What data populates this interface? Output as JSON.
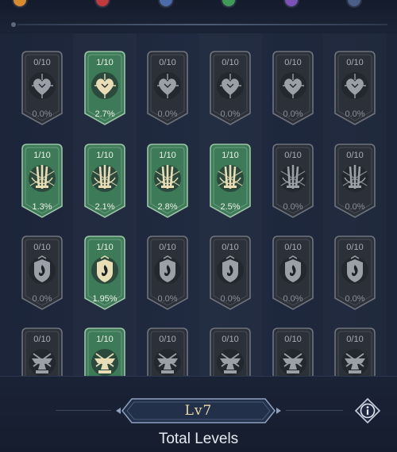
{
  "top_tabs": [
    {
      "icon": "orange-element-icon",
      "color": "#d98a2a"
    },
    {
      "icon": "red-element-icon",
      "color": "#c0393c"
    },
    {
      "icon": "blue-element-icon",
      "color": "#4a6aa8"
    },
    {
      "icon": "green-element-icon",
      "color": "#3f9a58"
    },
    {
      "icon": "purple-element-icon",
      "color": "#7a52b8"
    },
    {
      "icon": "navy-element-icon",
      "color": "#4b5e86"
    }
  ],
  "colors": {
    "active_fill": "#3d7a57",
    "inactive_fill": "#2c3038",
    "level_text": "#ecd9a6"
  },
  "rows": [
    {
      "emblem": "heart-icon",
      "cells": [
        {
          "level": "0/10",
          "percent": "0.0%",
          "active": false
        },
        {
          "level": "1/10",
          "percent": "2.7%",
          "active": true
        },
        {
          "level": "0/10",
          "percent": "0.0%",
          "active": false
        },
        {
          "level": "0/10",
          "percent": "0.0%",
          "active": false
        },
        {
          "level": "0/10",
          "percent": "0.0%",
          "active": false
        },
        {
          "level": "0/10",
          "percent": "0.0%",
          "active": false
        }
      ]
    },
    {
      "emblem": "swords-icon",
      "cells": [
        {
          "level": "1/10",
          "percent": "1.3%",
          "active": true
        },
        {
          "level": "1/10",
          "percent": "2.1%",
          "active": true
        },
        {
          "level": "1/10",
          "percent": "2.8%",
          "active": true
        },
        {
          "level": "1/10",
          "percent": "2.5%",
          "active": true
        },
        {
          "level": "0/10",
          "percent": "0.0%",
          "active": false
        },
        {
          "level": "0/10",
          "percent": "0.0%",
          "active": false
        }
      ]
    },
    {
      "emblem": "flame-crest-icon",
      "cells": [
        {
          "level": "0/10",
          "percent": "0.0%",
          "active": false
        },
        {
          "level": "1/10",
          "percent": "1.95%",
          "active": true
        },
        {
          "level": "0/10",
          "percent": "0.0%",
          "active": false
        },
        {
          "level": "0/10",
          "percent": "0.0%",
          "active": false
        },
        {
          "level": "0/10",
          "percent": "0.0%",
          "active": false
        },
        {
          "level": "0/10",
          "percent": "0.0%",
          "active": false
        }
      ]
    },
    {
      "emblem": "anvil-icon",
      "cells": [
        {
          "level": "0/10",
          "percent": "",
          "active": false
        },
        {
          "level": "1/10",
          "percent": "",
          "active": true
        },
        {
          "level": "0/10",
          "percent": "",
          "active": false
        },
        {
          "level": "0/10",
          "percent": "",
          "active": false
        },
        {
          "level": "0/10",
          "percent": "",
          "active": false
        },
        {
          "level": "0/10",
          "percent": "",
          "active": false
        }
      ]
    }
  ],
  "footer": {
    "level_value": "Lv7",
    "label": "Total Levels",
    "info_icon": "info-icon"
  }
}
